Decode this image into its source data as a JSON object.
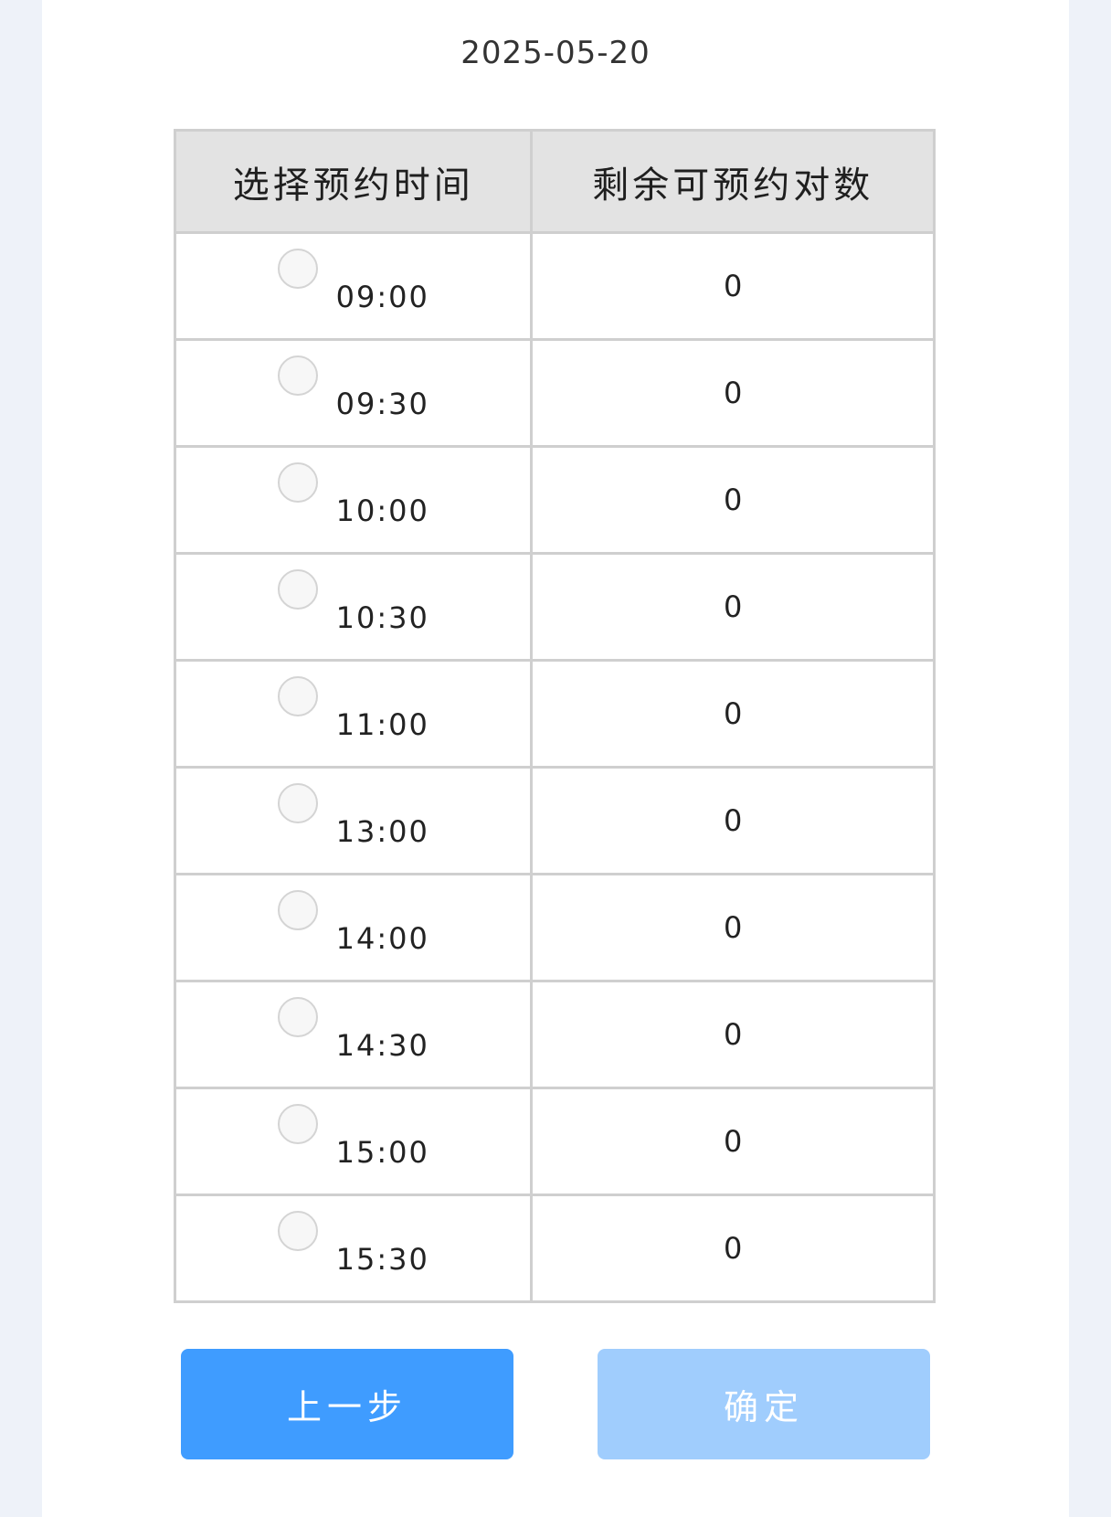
{
  "date": "2025-05-20",
  "table": {
    "headers": {
      "time": "选择预约时间",
      "remaining": "剩余可预约对数"
    },
    "rows": [
      {
        "time": "09:00",
        "remaining": "0"
      },
      {
        "time": "09:30",
        "remaining": "0"
      },
      {
        "time": "10:00",
        "remaining": "0"
      },
      {
        "time": "10:30",
        "remaining": "0"
      },
      {
        "time": "11:00",
        "remaining": "0"
      },
      {
        "time": "13:00",
        "remaining": "0"
      },
      {
        "time": "14:00",
        "remaining": "0"
      },
      {
        "time": "14:30",
        "remaining": "0"
      },
      {
        "time": "15:00",
        "remaining": "0"
      },
      {
        "time": "15:30",
        "remaining": "0"
      }
    ]
  },
  "buttons": {
    "prev": "上一步",
    "confirm": "确定"
  },
  "colors": {
    "page_background": "#eef2f9",
    "panel_background": "#ffffff",
    "header_background": "#e3e3e3",
    "border": "#cfcfcf",
    "prev_button": "#3f9cff",
    "confirm_button_disabled": "#a0cdfd"
  }
}
